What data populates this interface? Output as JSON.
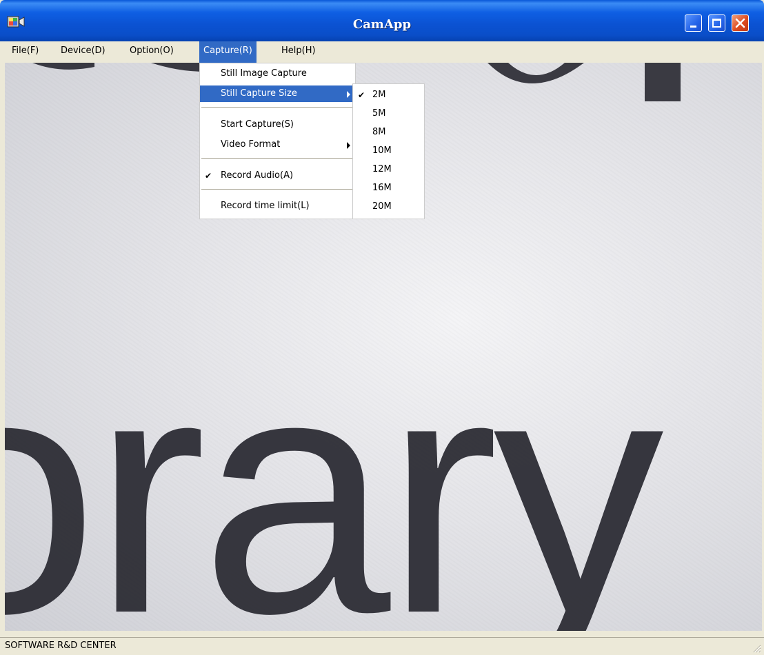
{
  "window": {
    "title": "CamApp",
    "icon": "camera-app-icon"
  },
  "title_buttons": {
    "minimize": "minimize-icon",
    "maximize": "maximize-icon",
    "close": "close-icon"
  },
  "menubar": {
    "items": [
      {
        "label": "File(F)"
      },
      {
        "label": "Device(D)"
      },
      {
        "label": "Option(O)"
      },
      {
        "label": "Capture(R)",
        "active": true
      },
      {
        "label": "Help(H)"
      }
    ]
  },
  "capture_menu": {
    "items": [
      {
        "label": "Still Image Capture"
      },
      {
        "label": "Still Capture Size",
        "has_submenu": true,
        "highlighted": true
      },
      {
        "label": "Start Capture(S)"
      },
      {
        "label": "Video Format",
        "has_submenu": true
      },
      {
        "label": "Record Audio(A)",
        "checked": true,
        "check_glyph": "✔"
      },
      {
        "label": "Record time limit(L)"
      }
    ]
  },
  "size_submenu": {
    "items": [
      {
        "label": "2M",
        "checked": true,
        "check_glyph": "✔"
      },
      {
        "label": "5M"
      },
      {
        "label": "8M"
      },
      {
        "label": "10M"
      },
      {
        "label": "12M"
      },
      {
        "label": "16M"
      },
      {
        "label": "20M"
      }
    ]
  },
  "preview": {
    "text": "orary"
  },
  "status": {
    "text": "SOFTWARE R&D CENTER"
  },
  "colors": {
    "titlebar": "#0b52d2",
    "highlight": "#316ac5",
    "chrome": "#ece9d8",
    "ink": "#2c2c34"
  }
}
